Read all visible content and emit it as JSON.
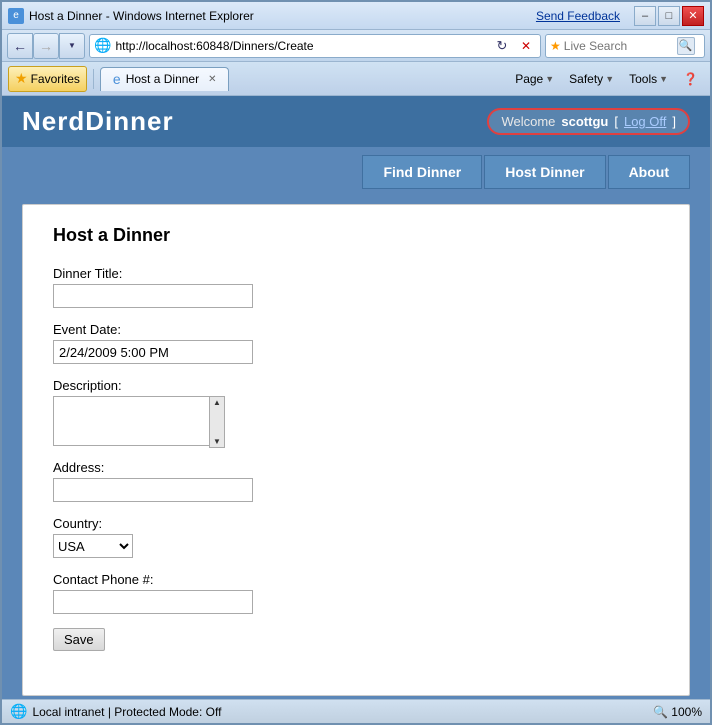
{
  "window": {
    "title": "Host a Dinner - Windows Internet Explorer",
    "send_feedback": "Send Feedback"
  },
  "address_bar": {
    "url": "http://localhost:60848/Dinners/Create",
    "search_placeholder": "Live Search"
  },
  "toolbar": {
    "favorites_label": "Favorites",
    "tab_label": "Host a Dinner"
  },
  "toolbar_buttons": {
    "page_label": "Page",
    "safety_label": "Safety",
    "tools_label": "Tools"
  },
  "header": {
    "site_title": "NerdDinner",
    "welcome_prefix": "Welcome",
    "username": "scottgu",
    "bracket_open": "[ ",
    "logoff_label": "Log Off",
    "bracket_close": " ]"
  },
  "nav": {
    "tabs": [
      {
        "label": "Find Dinner",
        "active": false
      },
      {
        "label": "Host Dinner",
        "active": false
      },
      {
        "label": "About",
        "active": false
      }
    ]
  },
  "form": {
    "page_title": "Host a Dinner",
    "fields": [
      {
        "label": "Dinner Title:",
        "type": "text",
        "value": "",
        "id": "dinner-title"
      },
      {
        "label": "Event Date:",
        "type": "text",
        "value": "2/24/2009 5:00 PM",
        "id": "event-date"
      },
      {
        "label": "Description:",
        "type": "textarea",
        "value": "",
        "id": "description"
      },
      {
        "label": "Address:",
        "type": "text",
        "value": "",
        "id": "address"
      },
      {
        "label": "Country:",
        "type": "select",
        "value": "USA",
        "id": "country",
        "options": [
          "USA"
        ]
      },
      {
        "label": "Contact Phone #:",
        "type": "text",
        "value": "",
        "id": "contact-phone"
      }
    ],
    "save_label": "Save"
  },
  "status_bar": {
    "zone": "Local intranet | Protected Mode: Off",
    "zoom": "100%"
  }
}
